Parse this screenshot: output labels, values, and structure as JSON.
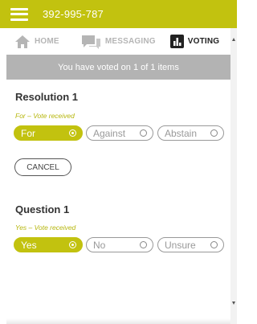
{
  "header": {
    "phone": "392-995-787",
    "accent_color": "#c2c20f"
  },
  "tabs": [
    {
      "label": "HOME",
      "icon": "home-icon",
      "active": false
    },
    {
      "label": "MESSAGING",
      "icon": "messaging-icon",
      "active": false
    },
    {
      "label": "VOTING",
      "icon": "voting-icon",
      "active": true
    }
  ],
  "status": {
    "text": "You have voted on 1 of 1 items"
  },
  "resolution": {
    "title": "Resolution 1",
    "status": "For – Vote received",
    "options": [
      "For",
      "Against",
      "Abstain"
    ],
    "selected": "For",
    "cancel_label": "CANCEL"
  },
  "question": {
    "title": "Question 1",
    "status": "Yes – Vote received",
    "options": [
      "Yes",
      "No",
      "Unsure"
    ],
    "selected": "Yes"
  }
}
